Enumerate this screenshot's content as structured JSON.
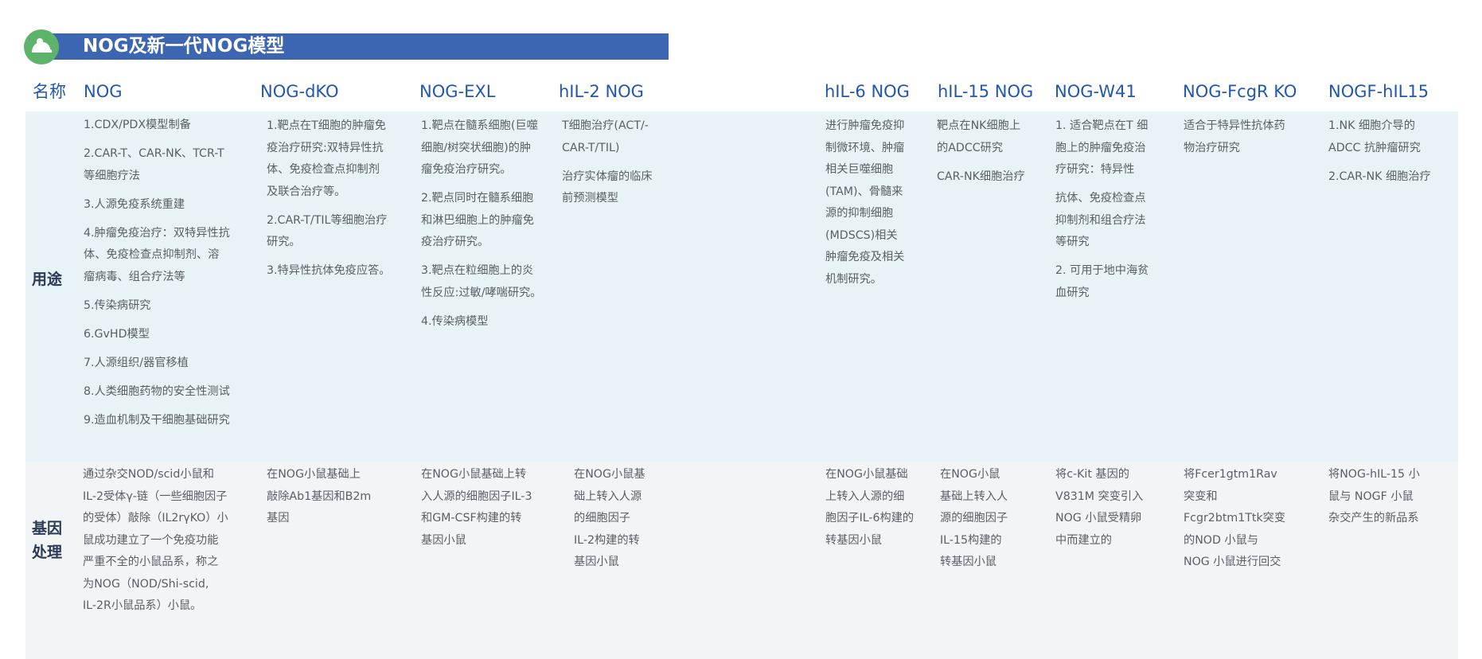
{
  "header": {
    "title": "NOG及新一代NOG模型"
  },
  "table": {
    "name_label": "名称",
    "usage_label": "用途",
    "gene_label": "基因\n处理",
    "columns": [
      "NOG",
      "NOG-dKO",
      "NOG-EXL",
      "hIL-2 NOG",
      "hIL-6 NOG",
      "hIL-15 NOG",
      "NOG-W41",
      "NOG-FcgR KO",
      "NOGF-hIL15"
    ],
    "usage": [
      [
        "1.CDX/PDX模型制备",
        "2.CAR-T、CAR-NK、TCR-T\n等细胞疗法",
        "3.人源免疫系统重建",
        "4.肿瘤免疫治疗：双特异性抗\n体、免疫检查点抑制剂、溶\n瘤病毒、组合疗法等",
        "5.传染病研究",
        "6.GvHD模型",
        "7.人源组织/器官移植",
        "8.人类细胞药物的安全性测试",
        "9.造血机制及干细胞基础研究"
      ],
      [
        "1.靶点在T细胞的肿瘤免\n疫治疗研究:双特异性抗\n体、免疫检查点抑制剂\n及联合治疗等。",
        "2.CAR-T/TIL等细胞治疗\n研究。",
        "3.特异性抗体免疫应答。"
      ],
      [
        "1.靶点在髓系细胞(巨噬\n细胞/树突状细胞)的肿\n瘤免疫治疗研究。",
        "2.靶点同时在髓系细胞\n和淋巴细胞上的肿瘤免\n疫治疗研究。",
        "3.靶点在粒细胞上的炎\n性反应:过敏/哮喘研究。",
        "4.传染病模型"
      ],
      [
        "T细胞治疗(ACT/-\nCAR-T/TIL)",
        "治疗实体瘤的临床\n前预测模型"
      ],
      [
        "进行肿瘤免疫抑\n制微环境、肿瘤\n相关巨噬细胞\n(TAM)、骨髓来\n源的抑制细胞\n(MDSCS)相关\n肿瘤免疫及相关\n机制研究。"
      ],
      [
        "靶点在NK细胞上\n的ADCC研究",
        "CAR-NK细胞治疗"
      ],
      [
        "1. 适合靶点在T 细\n胞上的肿瘤免疫治\n疗研究：特异性",
        "抗体、免疫检查点\n抑制剂和组合疗法\n等研究",
        "2. 可用于地中海贫\n血研究"
      ],
      [
        "适合于特异性抗体药\n物治疗研究"
      ],
      [
        "1.NK 细胞介导的\nADCC 抗肿瘤研究",
        "2.CAR-NK 细胞治疗"
      ]
    ],
    "gene": [
      "通过杂交NOD/scid小鼠和\nIL-2受体γ-链（一些细胞因子\n的受体）敲除（IL2rγKO）小\n鼠成功建立了一个免疫功能\n严重不全的小鼠品系，称之\n为NOG（NOD/Shi-scid,\nIL-2R小鼠品系）小鼠。",
      "在NOG小鼠基础上\n敲除Ab1基因和B2m\n基因",
      "在NOG小鼠基础上转\n入人源的细胞因子IL-3\n和GM-CSF构建的转\n基因小鼠",
      "在NOG小鼠基\n础上转入人源\n的细胞因子\nIL-2构建的转\n基因小鼠",
      "在NOG小鼠基础\n上转入人源的细\n胞因子IL-6构建的\n转基因小鼠",
      "在NOG小鼠\n基础上转入人\n源的细胞因子\nIL-15构建的\n转基因小鼠",
      "将c-Kit 基因的\nV831M 突变引入\nNOG 小鼠受精卵\n中而建立的",
      "将Fcer1gtm1Rav\n突变和\nFcgr2btm1Ttk突变\n的NOD 小鼠与\nNOG 小鼠进行回交",
      "将NOG-hIL-15 小\n鼠与 NOGF 小鼠\n杂交产生的新品系"
    ]
  }
}
